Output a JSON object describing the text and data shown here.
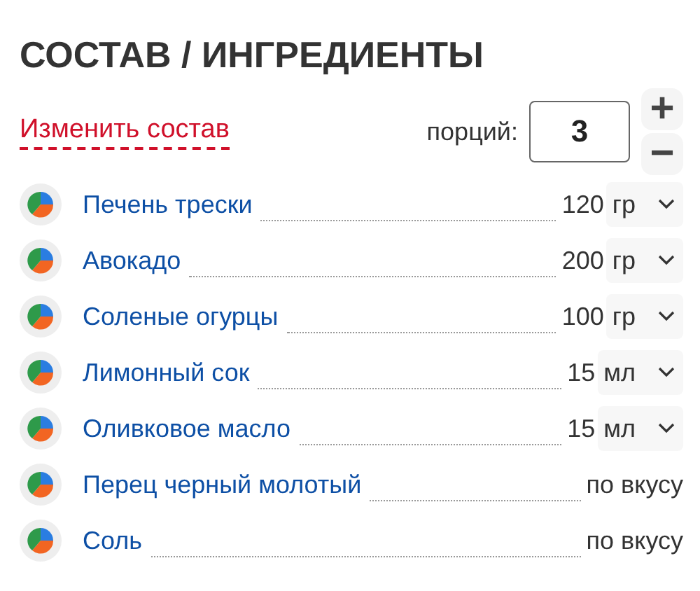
{
  "title": "СОСТАВ / ИНГРЕДИЕНТЫ",
  "edit_link": "Изменить состав",
  "servings": {
    "label": "порций:",
    "value": "3",
    "increase": "+",
    "decrease": "−"
  },
  "ingredients": [
    {
      "kind": "measured",
      "name": "Печень трески",
      "amount": "120",
      "unit": "гр"
    },
    {
      "kind": "measured",
      "name": "Авокадо",
      "amount": "200",
      "unit": "гр"
    },
    {
      "kind": "measured",
      "name": "Соленые огурцы",
      "amount": "100",
      "unit": "гр"
    },
    {
      "kind": "measured",
      "name": "Лимонный сок",
      "amount": "15",
      "unit": "мл"
    },
    {
      "kind": "measured",
      "name": "Оливковое масло",
      "amount": "15",
      "unit": "мл"
    },
    {
      "kind": "to_taste",
      "name": "Перец черный молотый",
      "amount": "по вкусу"
    },
    {
      "kind": "to_taste",
      "name": "Соль",
      "amount": "по вкусу"
    }
  ]
}
